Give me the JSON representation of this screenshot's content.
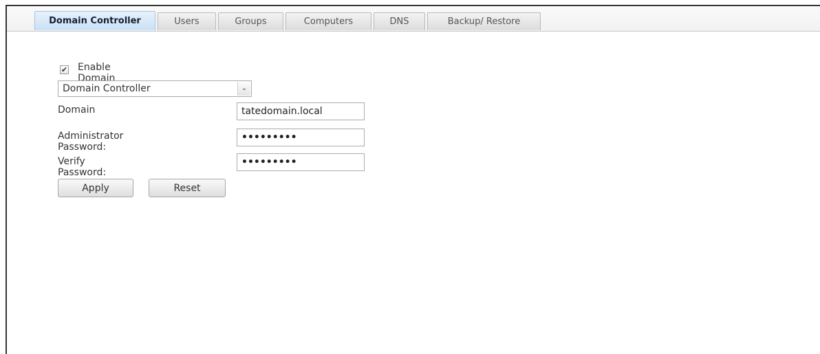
{
  "tabs": [
    {
      "label": "Domain Controller",
      "active": true
    },
    {
      "label": "Users",
      "active": false
    },
    {
      "label": "Groups",
      "active": false
    },
    {
      "label": "Computers",
      "active": false
    },
    {
      "label": "DNS",
      "active": false
    },
    {
      "label": "Backup/ Restore",
      "active": false
    }
  ],
  "form": {
    "enable_checkbox": {
      "label": "Enable Domain Controller",
      "checked": true,
      "check_glyph": "✔"
    },
    "mode_select": {
      "value": "Domain Controller",
      "arrow_icon": "chevron-down-icon",
      "arrow_glyph": "⌄"
    },
    "domain": {
      "label": "Domain",
      "value": "tatedomain.local"
    },
    "admin_password": {
      "label": "Administrator Password:",
      "value": "•••••••••"
    },
    "verify_password": {
      "label": "Verify Password:",
      "value": "•••••••••"
    },
    "apply_label": "Apply",
    "reset_label": "Reset"
  },
  "colors": {
    "active_tab": "#c9e0f5",
    "tab": "#dcdcdc",
    "frame_border": "#333333"
  }
}
